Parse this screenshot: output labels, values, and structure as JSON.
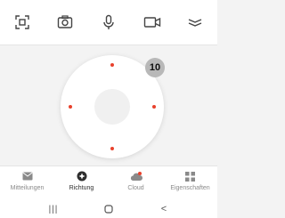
{
  "toolbar": {
    "items": [
      {
        "name": "screenshot-frame-icon"
      },
      {
        "name": "camera-icon"
      },
      {
        "name": "microphone-icon"
      },
      {
        "name": "video-record-icon"
      },
      {
        "name": "menu-chevron-icon"
      }
    ]
  },
  "control": {
    "badge": "10",
    "accent": "#e8412c"
  },
  "tabs": [
    {
      "label": "Mitteilungen",
      "icon": "message-icon",
      "active": false
    },
    {
      "label": "Richtung",
      "icon": "direction-icon",
      "active": true
    },
    {
      "label": "Cloud",
      "icon": "cloud-icon",
      "active": false
    },
    {
      "label": "Eigenschaften",
      "icon": "grid-icon",
      "active": false
    }
  ],
  "navbar": {
    "recent": "|||",
    "back": "<"
  }
}
